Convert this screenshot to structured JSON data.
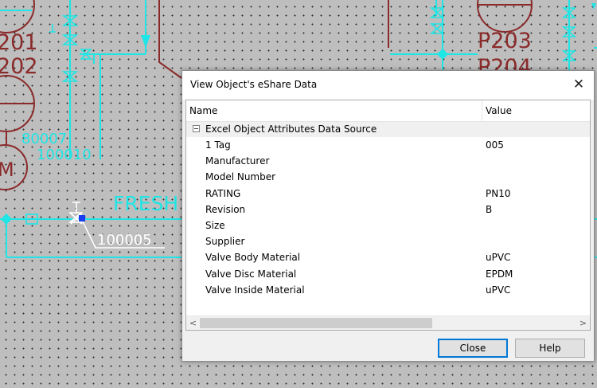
{
  "cad": {
    "tags": {
      "p201": "201",
      "p202": "202",
      "p203": "P203",
      "p204": "P204",
      "motor": "M",
      "line_80007": "80007",
      "line_100010": "100010",
      "valve_tag": "100005",
      "fresh": "FRESH"
    },
    "colors": {
      "background": "#bebebe",
      "cyan_line": "#1ee6e6",
      "equipment_red": "#8b2a2a",
      "white_callout": "#ffffff",
      "selection_blue": "#1a3cf0"
    }
  },
  "dialog": {
    "title": "View Object's eShare Data",
    "close_glyph": "✕",
    "columns": {
      "name": "Name",
      "value": "Value"
    },
    "group": {
      "label": "Excel Object Attributes Data Source",
      "expander": "minus-box"
    },
    "rows": [
      {
        "name": "1 Tag",
        "value": "005"
      },
      {
        "name": "Manufacturer",
        "value": ""
      },
      {
        "name": "Model Number",
        "value": ""
      },
      {
        "name": "RATING",
        "value": "PN10"
      },
      {
        "name": "Revision",
        "value": "B"
      },
      {
        "name": "Size",
        "value": ""
      },
      {
        "name": "Supplier",
        "value": ""
      },
      {
        "name": "Valve Body Material",
        "value": "uPVC"
      },
      {
        "name": "Valve Disc Material",
        "value": "EPDM"
      },
      {
        "name": "Valve Inside Material",
        "value": "uPVC"
      }
    ],
    "scrollbar": {
      "left_arrow": "<",
      "right_arrow": ">"
    },
    "buttons": {
      "close": "Close",
      "help": "Help"
    }
  }
}
